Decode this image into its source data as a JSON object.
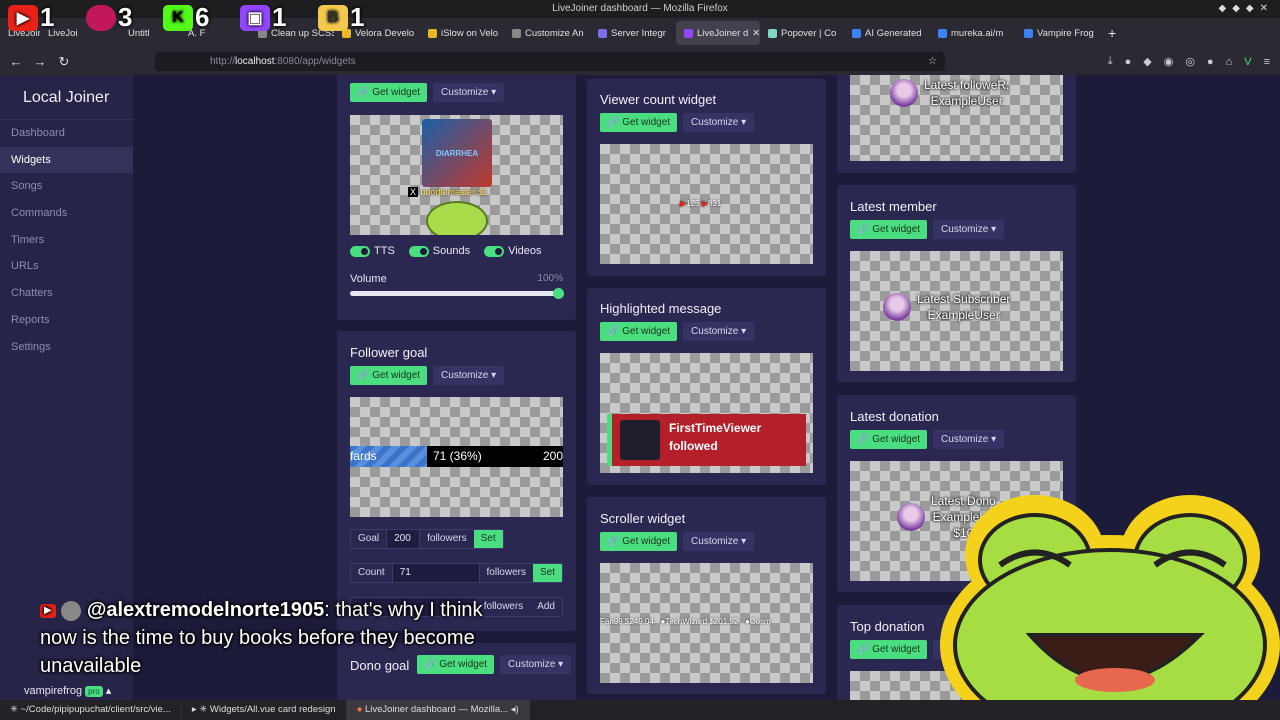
{
  "window": {
    "title": "LiveJoiner dashboard — Mozilla Firefox"
  },
  "stream_stats": [
    {
      "icon": "youtube-icon",
      "count": "1",
      "color": "#e62117"
    },
    {
      "icon": "pill-icon",
      "count": "3",
      "color": "#c2185b"
    },
    {
      "icon": "kick-icon",
      "count": "6",
      "color": "#53fc18"
    },
    {
      "icon": "twitch-icon",
      "count": "1",
      "color": "#9146ff"
    },
    {
      "icon": "b-badge-icon",
      "count": "1",
      "color": "#f2c94c"
    }
  ],
  "tabs": [
    {
      "label": "LiveJoine"
    },
    {
      "label": "LiveJoi"
    },
    {
      "label": "Untitl"
    },
    {
      "label": "A. F"
    },
    {
      "label": "Clean up SCSS"
    },
    {
      "label": "Velora Develo"
    },
    {
      "label": "iSlow on Velo"
    },
    {
      "label": "Customize An"
    },
    {
      "label": "Server Integr"
    },
    {
      "label": "LiveJoiner d"
    },
    {
      "label": "Popover | Co"
    },
    {
      "label": "AI Generated"
    },
    {
      "label": "mureka.ai/m"
    },
    {
      "label": "Vampire Frog"
    }
  ],
  "url": {
    "prefix": "http://",
    "host": "localhost",
    "rest": ":8080/app/widgets"
  },
  "sidebar": {
    "brand": "Local Joiner",
    "items": [
      {
        "label": "Dashboard"
      },
      {
        "label": "Widgets"
      },
      {
        "label": "Songs"
      },
      {
        "label": "Commands"
      },
      {
        "label": "Timers"
      },
      {
        "label": "URLs"
      },
      {
        "label": "Chatters"
      },
      {
        "label": "Reports"
      },
      {
        "label": "Settings"
      }
    ],
    "user": "vampirefrog",
    "user_badge": "pro"
  },
  "common": {
    "get_widget": "Get widget",
    "customize": "Customize"
  },
  "widgets": {
    "media": {
      "overlay_title": "DIARRHEA",
      "donation": "noodlemaster $1",
      "toggles": [
        {
          "label": "TTS"
        },
        {
          "label": "Sounds"
        },
        {
          "label": "Videos"
        }
      ],
      "volume_label": "Volume",
      "volume_value": "100%"
    },
    "follower_goal": {
      "title": "Follower goal",
      "bar_label": "fards",
      "bar_value": "71 (36%)",
      "bar_target": "200",
      "progress": 0.36,
      "goal_label": "Goal",
      "goal_value": "200",
      "goal_unit": "followers",
      "set_label": "Set",
      "count_label": "Count",
      "count_value": "71",
      "count_unit": "followers",
      "add_unit": "followers",
      "add_label": "Add"
    },
    "dono_goal": {
      "title": "Dono goal"
    },
    "viewer_count": {
      "title": "Viewer count widget",
      "yt": "125",
      "twitch": "831"
    },
    "highlighted": {
      "title": "Highlighted message",
      "name": "FirstTimeViewer",
      "action": "followed"
    },
    "scroller": {
      "title": "Scroller widget",
      "items": [
        "Fan99 $249.04",
        "TechWizard $201.52",
        "Cosm"
      ]
    },
    "latest_follower": {
      "line1": "Latest followeR:",
      "line2": "ExampleUser"
    },
    "latest_member": {
      "title": "Latest member",
      "line1": "Latest Subscriber",
      "line2": "ExampleUser"
    },
    "latest_donation": {
      "title": "Latest donation",
      "line1": "Latest Dono",
      "line2": "ExampleUs",
      "line3": "$10"
    },
    "top_donation": {
      "title": "Top donation"
    }
  },
  "chat_overlay": {
    "username": "@alextremodelnorte1905",
    "message": ": that's why I think now is the time to buy books before they become unavailable"
  },
  "taskbar": [
    {
      "label": "~/Code/pipipupuchat/client/src/vie..."
    },
    {
      "label": "✳ Widgets/All.vue card redesign"
    },
    {
      "label": "LiveJoiner dashboard — Mozilla..."
    }
  ]
}
